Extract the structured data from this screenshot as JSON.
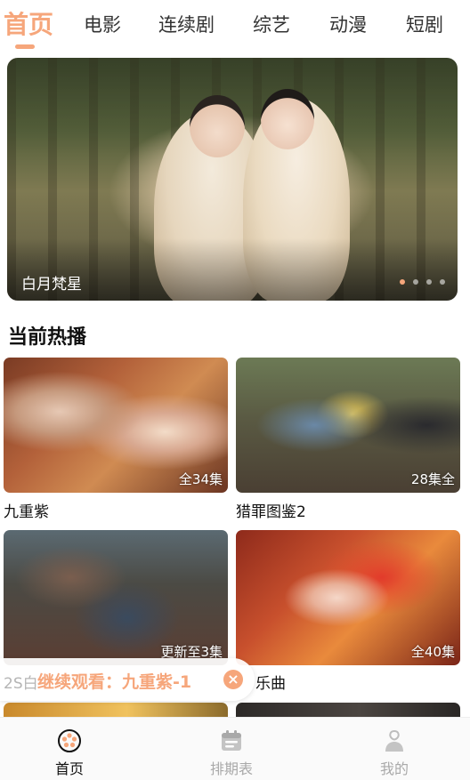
{
  "tabs": [
    {
      "label": "首页",
      "active": true
    },
    {
      "label": "电影"
    },
    {
      "label": "连续剧"
    },
    {
      "label": "综艺"
    },
    {
      "label": "动漫"
    },
    {
      "label": "短剧"
    }
  ],
  "banner": {
    "title": "白月梵星",
    "slide_count": 4,
    "active_slide": 1
  },
  "section": {
    "title": "当前热播"
  },
  "cards": [
    {
      "title": "九重紫",
      "badge": "全34集"
    },
    {
      "title": "猎罪图鉴2",
      "badge": "28集全"
    },
    {
      "title": "",
      "badge": "更新至3集"
    },
    {
      "title": "",
      "badge": "全40集"
    }
  ],
  "continue_watching": {
    "prefix": "2S白",
    "text": "继续观看：九重紫-1",
    "tail": "乐曲",
    "close_icon": "close-icon"
  },
  "bottom_nav": [
    {
      "label": "首页",
      "icon": "film-reel-icon",
      "active": true
    },
    {
      "label": "排期表",
      "icon": "calendar-icon"
    },
    {
      "label": "我的",
      "icon": "profile-icon"
    }
  ],
  "colors": {
    "accent": "#f6a67b",
    "text": "#111111",
    "muted": "#a9a9a9"
  }
}
